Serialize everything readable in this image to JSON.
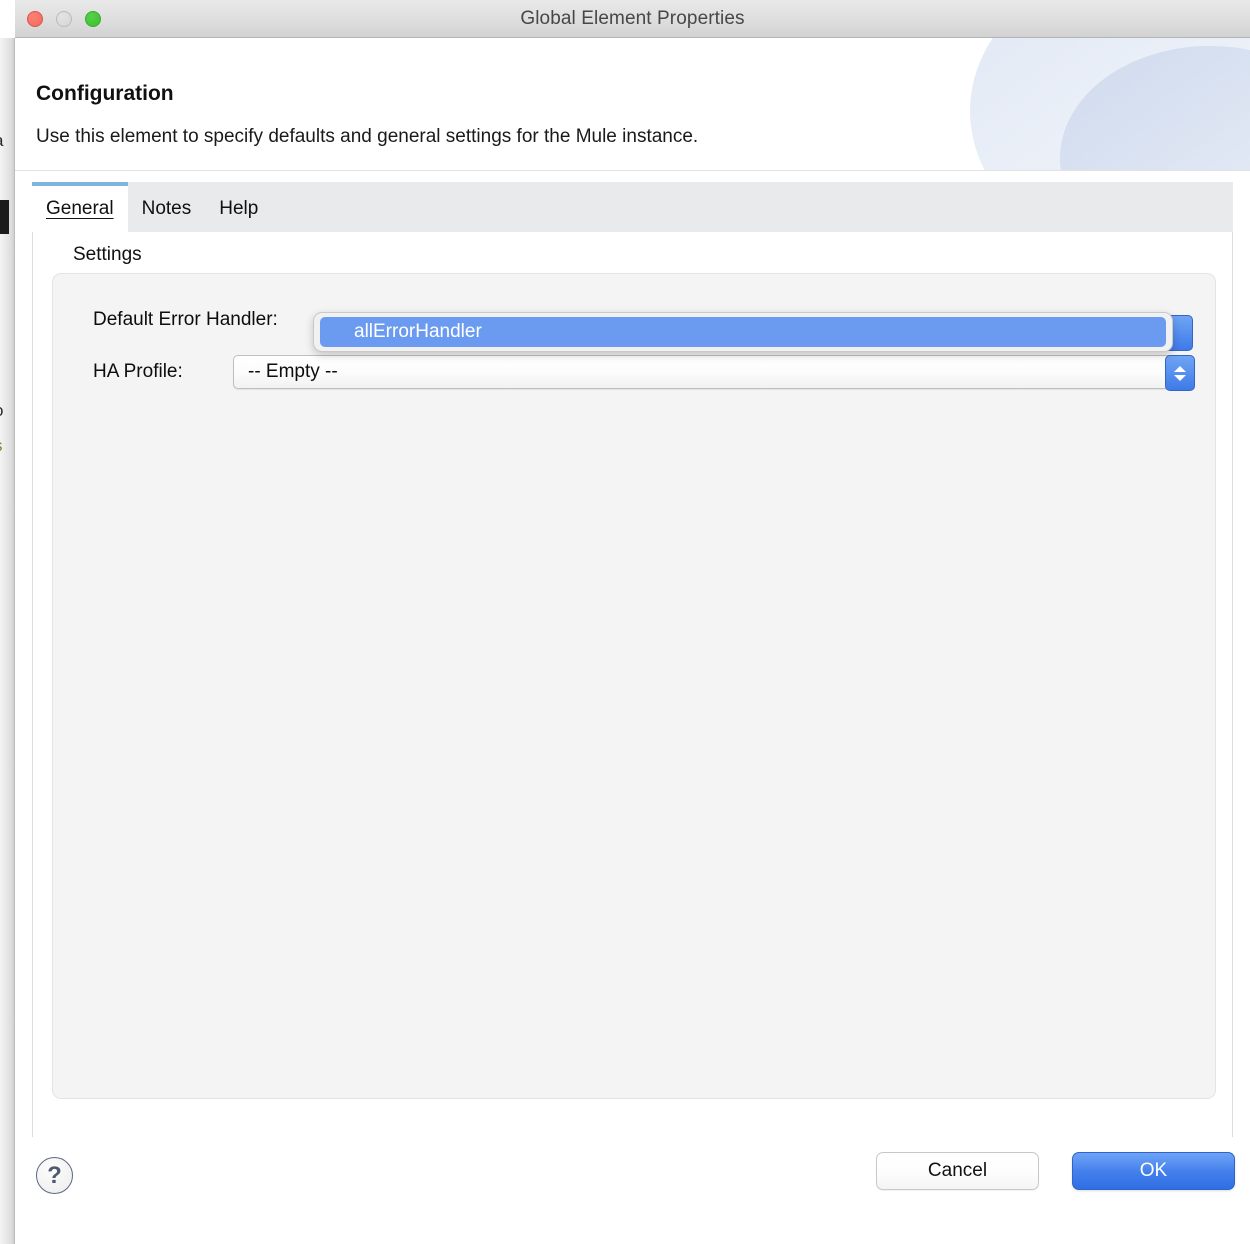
{
  "window": {
    "title": "Global Element Properties",
    "traffic_lights": [
      {
        "name": "close",
        "color": "#ef6a5c"
      },
      {
        "name": "minimize",
        "color": "#d5d5d5"
      },
      {
        "name": "zoom",
        "color": "#3ebd2f"
      }
    ]
  },
  "header": {
    "title": "Configuration",
    "description": "Use this element to specify defaults and general settings for the Mule instance."
  },
  "tabs": [
    {
      "label": "General",
      "active": true
    },
    {
      "label": "Notes",
      "active": false
    },
    {
      "label": "Help",
      "active": false
    }
  ],
  "content": {
    "group_label": "Settings",
    "fields": [
      {
        "label": "Default Error Handler:",
        "value": "allErrorHandler",
        "state": "open"
      },
      {
        "label": "HA Profile:",
        "value": "-- Empty --",
        "state": "closed"
      }
    ]
  },
  "dropdown": {
    "options": [
      {
        "label": "allErrorHandler",
        "selected": true
      }
    ]
  },
  "footer": {
    "help_label": "?",
    "cancel_label": "Cancel",
    "ok_label": "OK"
  },
  "colors": {
    "accent_blue": "#4480ec",
    "selection_blue": "#6b9bf0",
    "tab_active_bar": "#7fb4dd",
    "tabbar_gray": "#e8eaec",
    "panel_gray": "#f4f4f4"
  },
  "background_window": {
    "fragments": [
      "a",
      ".",
      "o",
      "s"
    ]
  }
}
